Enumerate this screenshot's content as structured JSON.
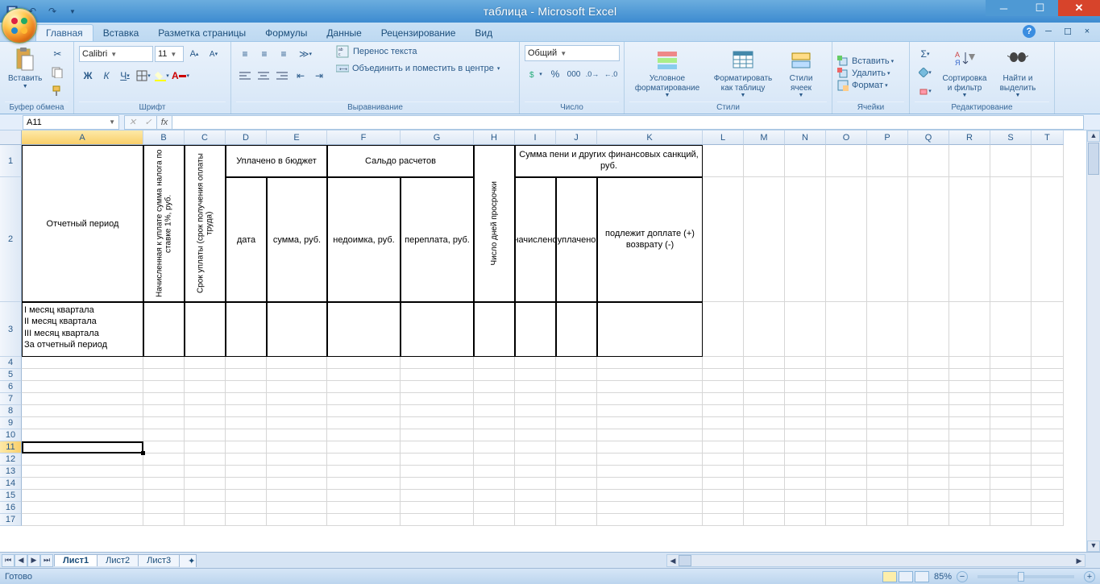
{
  "title": "таблица - Microsoft Excel",
  "tabs": [
    "Главная",
    "Вставка",
    "Разметка страницы",
    "Формулы",
    "Данные",
    "Рецензирование",
    "Вид"
  ],
  "active_tab": "Главная",
  "groups": {
    "clipboard": {
      "label": "Буфер обмена",
      "paste": "Вставить"
    },
    "font": {
      "label": "Шрифт",
      "name": "Calibri",
      "size": "11"
    },
    "alignment": {
      "label": "Выравнивание",
      "wrap": "Перенос текста",
      "merge": "Объединить и поместить в центре"
    },
    "number": {
      "label": "Число",
      "format": "Общий"
    },
    "styles": {
      "label": "Стили",
      "cond": "Условное форматирование",
      "table": "Форматировать как таблицу",
      "cell": "Стили ячеек"
    },
    "cells": {
      "label": "Ячейки",
      "insert": "Вставить",
      "delete": "Удалить",
      "format": "Формат"
    },
    "editing": {
      "label": "Редактирование",
      "sort": "Сортировка и фильтр",
      "find": "Найти и выделить"
    }
  },
  "namebox": "A11",
  "formula": "",
  "columns": [
    {
      "l": "A",
      "w": 151
    },
    {
      "l": "B",
      "w": 51
    },
    {
      "l": "C",
      "w": 51
    },
    {
      "l": "D",
      "w": 51
    },
    {
      "l": "E",
      "w": 75
    },
    {
      "l": "F",
      "w": 91
    },
    {
      "l": "G",
      "w": 91
    },
    {
      "l": "H",
      "w": 51
    },
    {
      "l": "I",
      "w": 51
    },
    {
      "l": "J",
      "w": 51
    },
    {
      "l": "K",
      "w": 131
    },
    {
      "l": "L",
      "w": 51
    },
    {
      "l": "M",
      "w": 51
    },
    {
      "l": "N",
      "w": 51
    },
    {
      "l": "O",
      "w": 51
    },
    {
      "l": "P",
      "w": 51
    },
    {
      "l": "Q",
      "w": 51
    },
    {
      "l": "R",
      "w": 51
    },
    {
      "l": "S",
      "w": 51
    },
    {
      "l": "T",
      "w": 40
    }
  ],
  "rows": [
    {
      "n": 1,
      "h": 40
    },
    {
      "n": 2,
      "h": 155
    },
    {
      "n": 3,
      "h": 68
    },
    {
      "n": 4,
      "h": 15
    },
    {
      "n": 5,
      "h": 15
    },
    {
      "n": 6,
      "h": 15
    },
    {
      "n": 7,
      "h": 15
    },
    {
      "n": 8,
      "h": 15
    },
    {
      "n": 9,
      "h": 15
    },
    {
      "n": 10,
      "h": 15
    },
    {
      "n": 11,
      "h": 15
    },
    {
      "n": 12,
      "h": 15
    },
    {
      "n": 13,
      "h": 15
    },
    {
      "n": 14,
      "h": 15
    },
    {
      "n": 15,
      "h": 15
    },
    {
      "n": 16,
      "h": 15
    },
    {
      "n": 17,
      "h": 15
    }
  ],
  "table": {
    "A12": "Отчетный период",
    "B12": "Начисленная к уплате сумма налога по ставке 1%, руб.",
    "C12": "Срок уплаты (срок получения оплаты труда)",
    "D1": "Уплачено в бюджет",
    "D2": "дата",
    "E2": "сумма, руб.",
    "F1": "Сальдо расчетов",
    "F2": "недоимка, руб.",
    "G2": "переплата, руб.",
    "H12": "Число дней просрочки",
    "I1": "Сумма пени и других финансовых санкций, руб.",
    "I2": "начислено",
    "J2": "уплачено",
    "K2": "подлежит доплате (+) возврату (-)",
    "A3": "I месяц квартала\nII месяц квартала\nIII месяц квартала\nЗа отчетный период"
  },
  "selected_cell": "A11",
  "sheets": [
    "Лист1",
    "Лист2",
    "Лист3"
  ],
  "active_sheet": "Лист1",
  "status": "Готово",
  "zoom": "85%"
}
